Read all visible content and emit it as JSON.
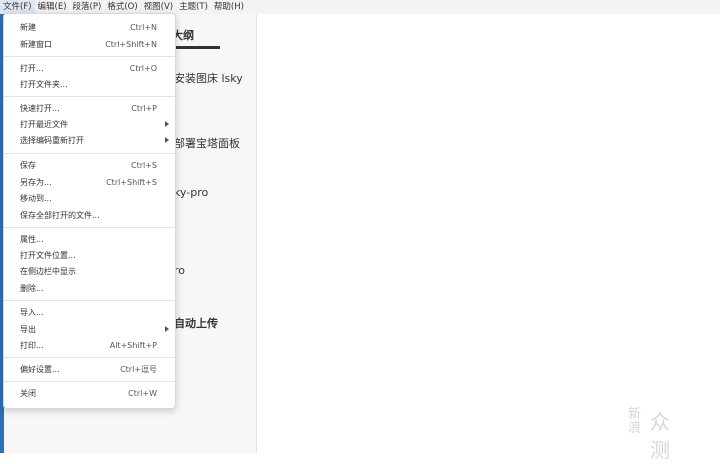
{
  "menubar": {
    "items": [
      "文件(F)",
      "编辑(E)",
      "段落(P)",
      "格式(O)",
      "视图(V)",
      "主题(T)",
      "帮助(H)"
    ]
  },
  "sidebar": {
    "tab_label": "大纲",
    "outline": [
      "安装图床 lsky",
      "部署宝塔面板",
      "ky-pro",
      "ro",
      "自动上传"
    ]
  },
  "file_menu": {
    "items": [
      {
        "label": "新建",
        "shortcut": "Ctrl+N"
      },
      {
        "label": "新建窗口",
        "shortcut": "Ctrl+Shift+N"
      },
      {
        "label": "打开...",
        "shortcut": "Ctrl+O"
      },
      {
        "label": "打开文件夹...",
        "shortcut": ""
      },
      {
        "label": "快速打开...",
        "shortcut": "Ctrl+P"
      },
      {
        "label": "打开最近文件",
        "shortcut": ""
      },
      {
        "label": "选择编码重新打开",
        "shortcut": ""
      },
      {
        "label": "保存",
        "shortcut": "Ctrl+S"
      },
      {
        "label": "另存为...",
        "shortcut": "Ctrl+Shift+S"
      },
      {
        "label": "移动到...",
        "shortcut": ""
      },
      {
        "label": "保存全部打开的文件...",
        "shortcut": ""
      },
      {
        "label": "属性...",
        "shortcut": ""
      },
      {
        "label": "打开文件位置...",
        "shortcut": ""
      },
      {
        "label": "在侧边栏中显示",
        "shortcut": ""
      },
      {
        "label": "删除...",
        "shortcut": ""
      },
      {
        "label": "导入...",
        "shortcut": ""
      },
      {
        "label": "导出",
        "shortcut": ""
      },
      {
        "label": "打印...",
        "shortcut": "Alt+Shift+P"
      },
      {
        "label": "偏好设置...",
        "shortcut": "Ctrl+逗号"
      },
      {
        "label": "关闭",
        "shortcut": "Ctrl+W"
      }
    ]
  },
  "watermark": {
    "line1": "新浪",
    "line2": "众测"
  },
  "colors": {
    "accent": "#2f6fb7",
    "menu_bg": "#ffffff",
    "menubar_bg": "#f3f3f3"
  }
}
